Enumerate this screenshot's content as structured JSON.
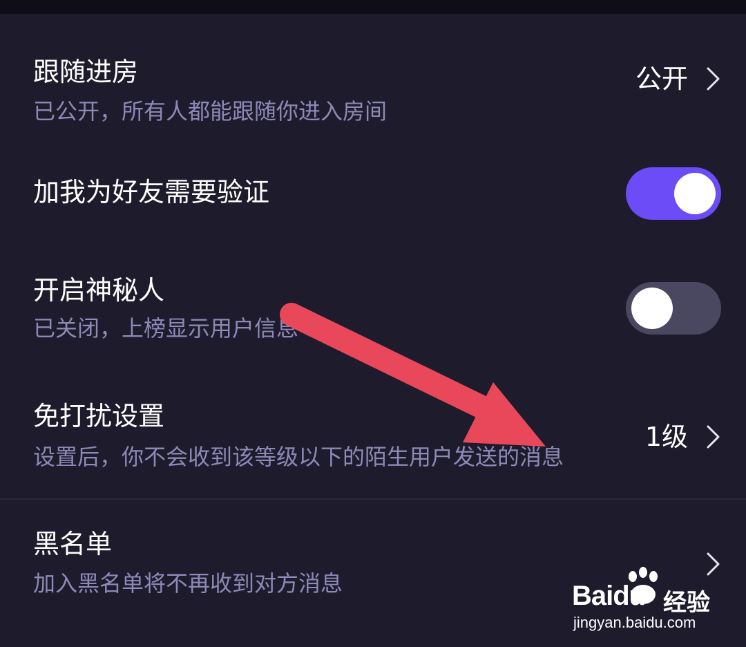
{
  "settings": [
    {
      "title": "跟随进房",
      "subtitle": "已公开，所有人都能跟随你进入房间",
      "value": "公开",
      "control": "chevron"
    },
    {
      "title": "加我为好友需要验证",
      "control": "toggle",
      "toggle_on": true
    },
    {
      "title": "开启神秘人",
      "subtitle": "已关闭，上榜显示用户信息",
      "control": "toggle",
      "toggle_on": false
    },
    {
      "title": "免打扰设置",
      "subtitle": "设置后，你不会收到该等级以下的陌生用户发送的消息",
      "value": "1级",
      "control": "chevron"
    },
    {
      "title": "黑名单",
      "subtitle": "加入黑名单将不再收到对方消息",
      "control": "chevron"
    }
  ],
  "watermark": {
    "brand": "Baidu",
    "product": "经验",
    "url": "jingyan.baidu.com"
  },
  "colors": {
    "background": "#1e1c2c",
    "toggle_on": "#6b4cf6",
    "toggle_off": "#4a4760",
    "subtitle": "#8d89b8",
    "arrow": "#e8485a"
  },
  "icons": [
    "chevron-right-icon",
    "red-arrow-annotation",
    "baidu-paw-logo"
  ]
}
